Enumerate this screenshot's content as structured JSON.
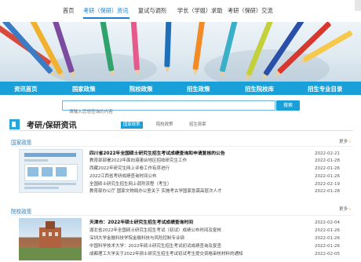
{
  "topnav": {
    "items": [
      "首页",
      "考研（保研）资讯",
      "复试与调剂",
      "学长（学姐）求助",
      "考研（保研）交流"
    ],
    "active_index": 1
  },
  "mainnav": {
    "items": [
      "资讯首页",
      "国家政策",
      "院校政策",
      "招生政策",
      "招生院校库",
      "招生专业目录"
    ]
  },
  "search": {
    "placeholder": "请输入您想查询的内容",
    "button": "搜索"
  },
  "section": {
    "title": "考研/保研资讯",
    "tabs": [
      "国家政策",
      "院校政策",
      "招生简章"
    ],
    "active_tab": 0
  },
  "more_label": "更多",
  "categories": [
    {
      "name": "国家政策",
      "items": [
        {
          "title": "四川省2022年全国硕士研究生招生考试成绩查询和申请复核的公告",
          "date": "2022-02-21",
          "lead": true
        },
        {
          "title": "教育部部署2022年面向港澳台地区招收研究生工作",
          "date": "2022-01-28"
        },
        {
          "title": "西藏2022年研究生网上评卷工作有序进行",
          "date": "2022-01-26"
        },
        {
          "title": "2022江西省考研成绩查询时间公布",
          "date": "2022-01-26"
        },
        {
          "title": "全国硕士研究生招生网上调剂流程（考生）",
          "date": "2022-02-19"
        },
        {
          "title": "教育部办公厅 国家文物局办公室关于 实施考古学国家急需高层次人才",
          "date": "2022-01-28"
        }
      ]
    },
    {
      "name": "院校政策",
      "items": [
        {
          "title": "天津市：2022年硕士研究生招生考试成绩查询时间",
          "date": "2022-02-04",
          "lead": true
        },
        {
          "title": "湖北省2022年全国硕士研究生招生考试（初试）成绩公布时间及复核",
          "date": "2022-01-26"
        },
        {
          "title": "深圳大学金融科技学院金融科技与风险控制专业硕",
          "date": "2022-01-26"
        },
        {
          "title": "中国科学技术大学：2022年硕士研究生招生考试初试成绩查询及复查",
          "date": "2022-01-26"
        },
        {
          "title": "成都理工大学关于2022年硕士研究生招生考试初试考生提交资格审核材料的通知",
          "date": "2022-02-05"
        }
      ]
    }
  ],
  "colors": {
    "primary": "#1aa0d8",
    "link": "#2b7fbf",
    "more_arrow": "#e06a1b"
  }
}
